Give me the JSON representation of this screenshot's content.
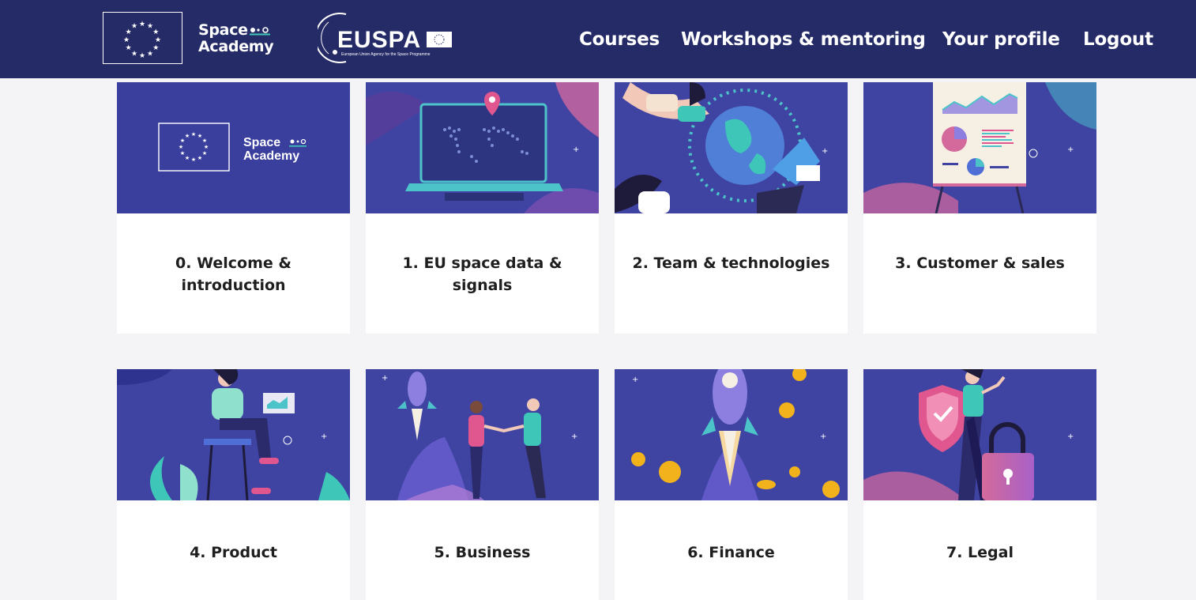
{
  "header": {
    "brand": {
      "line1": "Space",
      "line2": "Academy"
    },
    "partner_logo": {
      "name": "EUSPA",
      "caption": "European Union Agency for the Space Programme"
    },
    "nav": [
      {
        "label": "Courses"
      },
      {
        "label": "Workshops & mentoring"
      },
      {
        "label": "Your profile"
      },
      {
        "label": "Logout"
      }
    ]
  },
  "courses": [
    {
      "title": "0. Welcome & introduction",
      "illustration": "space-academy-logo"
    },
    {
      "title": "1. EU space data & signals",
      "illustration": "laptop-world-map"
    },
    {
      "title": "2. Team & technologies",
      "illustration": "people-globe"
    },
    {
      "title": "3. Customer & sales",
      "illustration": "presentation-board"
    },
    {
      "title": "4. Product",
      "illustration": "woman-laptop"
    },
    {
      "title": "5. Business",
      "illustration": "handshake-rocket"
    },
    {
      "title": "6. Finance",
      "illustration": "rocket-coins"
    },
    {
      "title": "7. Legal",
      "illustration": "shield-padlock"
    }
  ],
  "colors": {
    "header_bg": "#252b67",
    "card_image_bg": "#3f44a3",
    "accent_pink": "#e0578f",
    "accent_teal": "#3ec7b8",
    "page_bg": "#f4f4f6"
  }
}
